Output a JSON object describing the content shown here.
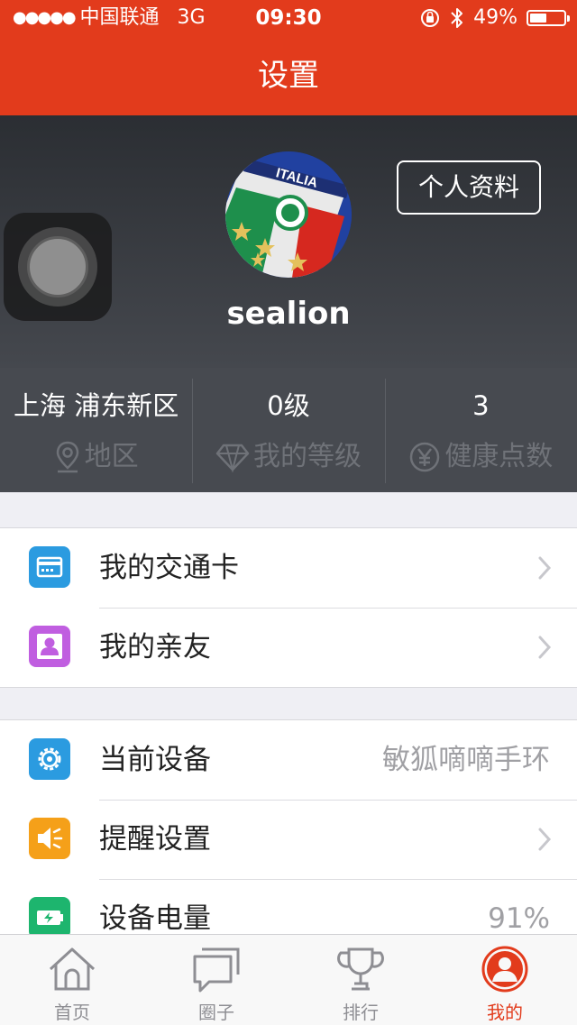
{
  "status_bar": {
    "carrier": "中国联通",
    "network": "3G",
    "time": "09:30",
    "battery_text": "49%",
    "battery_level": 0.49
  },
  "nav": {
    "title": "设置"
  },
  "profile": {
    "username": "sealion",
    "profile_button_label": "个人资料",
    "avatar_text": "ITALIA"
  },
  "stats": [
    {
      "value": "上海 浦东新区",
      "label": "地区",
      "icon": "location-pin-icon"
    },
    {
      "value": "0级",
      "label": "我的等级",
      "icon": "diamond-icon"
    },
    {
      "value": "3",
      "label": "健康点数",
      "icon": "yen-coin-icon"
    }
  ],
  "group1": [
    {
      "label": "我的交通卡",
      "icon": "transit-card-icon",
      "color": "#2b9be0"
    },
    {
      "label": "我的亲友",
      "icon": "contact-person-icon",
      "color": "#c05ee0"
    }
  ],
  "group2": [
    {
      "label": "当前设备",
      "value": "敏狐嘀嘀手环",
      "icon": "gear-icon",
      "color": "#2b9be0"
    },
    {
      "label": "提醒设置",
      "icon": "speaker-icon",
      "color": "#f5a019"
    },
    {
      "label": "设备电量",
      "value": "91%",
      "icon": "battery-charging-icon",
      "color": "#1db56e"
    }
  ],
  "tabs": [
    {
      "label": "首页",
      "icon": "home-icon"
    },
    {
      "label": "圈子",
      "icon": "chat-icon"
    },
    {
      "label": "排行",
      "icon": "trophy-icon"
    },
    {
      "label": "我的",
      "icon": "profile-icon",
      "active": true
    }
  ],
  "colors": {
    "brand": "#e23b1c",
    "header_dark": "#2b2e33",
    "inactive_tab": "#8e8e93"
  }
}
